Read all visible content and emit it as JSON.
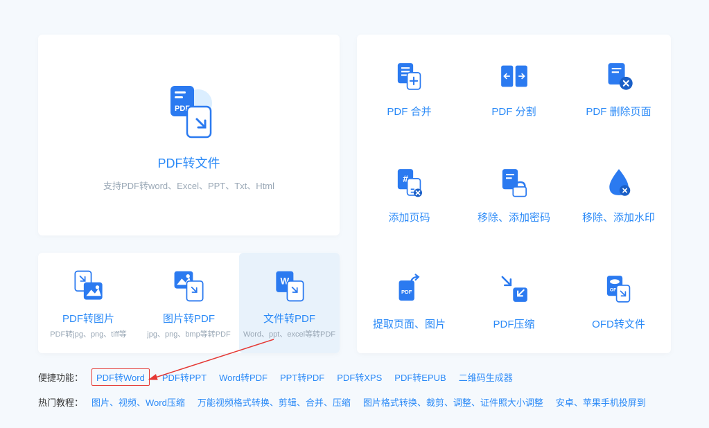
{
  "hero": {
    "title": "PDF转文件",
    "subtitle": "支持PDF转word、Excel、PPT、Txt、Html"
  },
  "left_features": [
    {
      "title": "PDF转图片",
      "subtitle": "PDF转jpg、png、tiff等"
    },
    {
      "title": "图片转PDF",
      "subtitle": "jpg、png、bmp等转PDF"
    },
    {
      "title": "文件转PDF",
      "subtitle": "Word、ppt、excel等转PDF"
    }
  ],
  "grid_items": [
    {
      "title": "PDF 合并",
      "icon": "merge"
    },
    {
      "title": "PDF 分割",
      "icon": "split"
    },
    {
      "title": "PDF 删除页面",
      "icon": "delete-page"
    },
    {
      "title": "添加页码",
      "icon": "page-number"
    },
    {
      "title": "移除、添加密码",
      "icon": "password"
    },
    {
      "title": "移除、添加水印",
      "icon": "watermark"
    },
    {
      "title": "提取页面、图片",
      "icon": "extract"
    },
    {
      "title": "PDF压缩",
      "icon": "compress"
    },
    {
      "title": "OFD转文件",
      "icon": "ofd"
    }
  ],
  "quick_links": {
    "label": "便捷功能：",
    "items": [
      "PDF转Word",
      "PDF转PPT",
      "Word转PDF",
      "PPT转PDF",
      "PDF转XPS",
      "PDF转EPUB",
      "二维码生成器"
    ]
  },
  "hot_tutorials": {
    "label": "热门教程：",
    "items": [
      "图片、视频、Word压缩",
      "万能视频格式转换、剪辑、合并、压缩",
      "图片格式转换、裁剪、调整、证件照大小调整",
      "安卓、苹果手机投屏到"
    ]
  }
}
